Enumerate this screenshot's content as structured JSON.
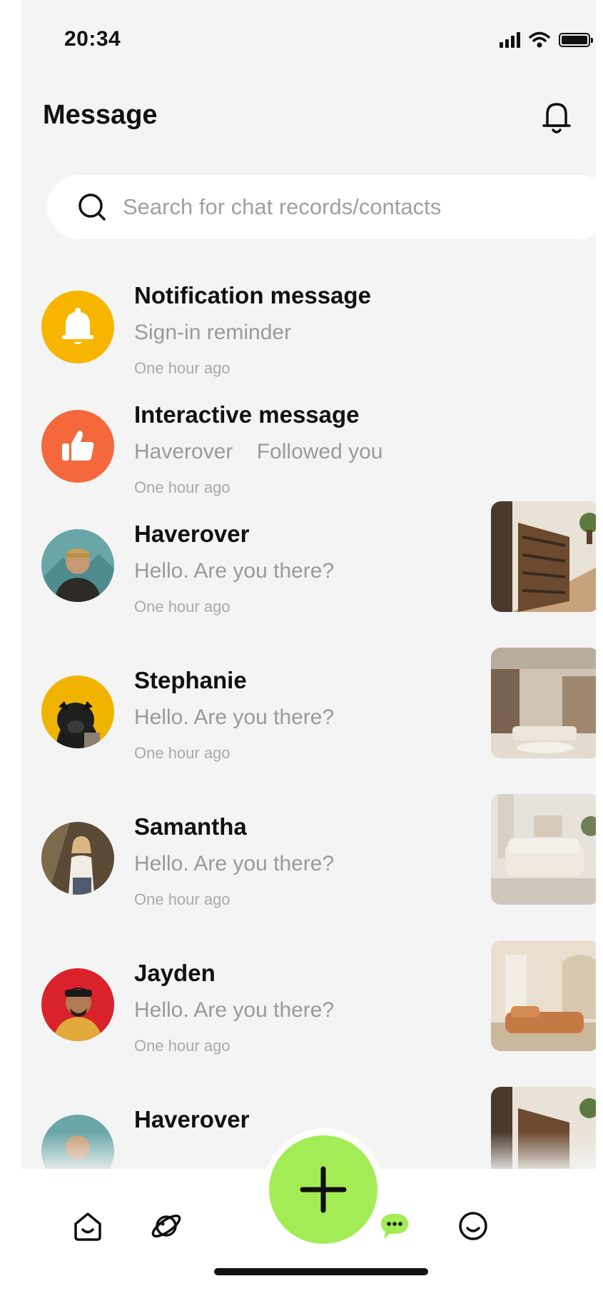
{
  "status_bar": {
    "time": "20:34"
  },
  "header": {
    "title": "Message"
  },
  "search": {
    "placeholder": "Search for chat records/contacts"
  },
  "messages": [
    {
      "name": "Notification message",
      "preview": "Sign-in reminder",
      "time": "One hour ago",
      "avatar": "bell-icon",
      "avatar_color": "#f7b500"
    },
    {
      "name": "Interactive message",
      "preview": "Haverover    Followed you",
      "time": "One hour ago",
      "avatar": "thumbs-up-icon",
      "avatar_color": "#f4683c"
    },
    {
      "name": "Haverover",
      "preview": "Hello. Are you there?",
      "time": "One hour ago"
    },
    {
      "name": "Stephanie",
      "preview": "Hello. Are you there?",
      "time": "One hour ago"
    },
    {
      "name": "Samantha",
      "preview": "Hello. Are you there?",
      "time": "One hour ago"
    },
    {
      "name": "Jayden",
      "preview": "Hello. Are you there?",
      "time": "One hour ago"
    },
    {
      "name": "Haverover",
      "preview": "",
      "time": ""
    }
  ],
  "nav": {
    "items": [
      "home-icon",
      "planet-icon",
      "add-icon",
      "message-icon",
      "profile-icon"
    ],
    "active": "message-icon",
    "accent": "#a3ec56"
  }
}
